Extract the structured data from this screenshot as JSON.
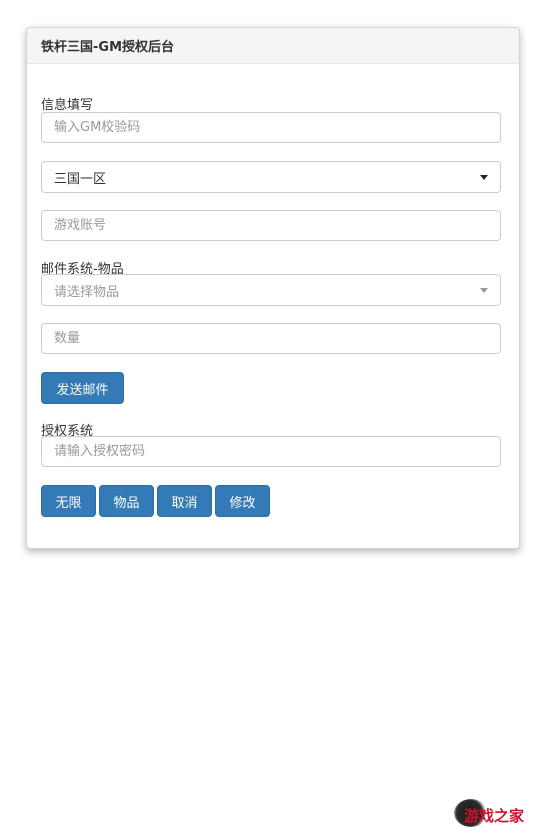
{
  "panel": {
    "title": "铁杆三国-GM授权后台"
  },
  "info": {
    "label": "信息填写",
    "gm_code_placeholder": "输入GM校验码",
    "server_selected": "三国一区",
    "account_placeholder": "游戏账号"
  },
  "mail": {
    "label": "邮件系统-物品",
    "item_placeholder": "请选择物品",
    "quantity_placeholder": "数量",
    "send_label": "发送邮件"
  },
  "auth": {
    "label": "授权系统",
    "password_placeholder": "请输入授权密码",
    "buttons": [
      "无限",
      "物品",
      "取消",
      "修改"
    ]
  },
  "watermark": {
    "text": "游戏之家"
  }
}
